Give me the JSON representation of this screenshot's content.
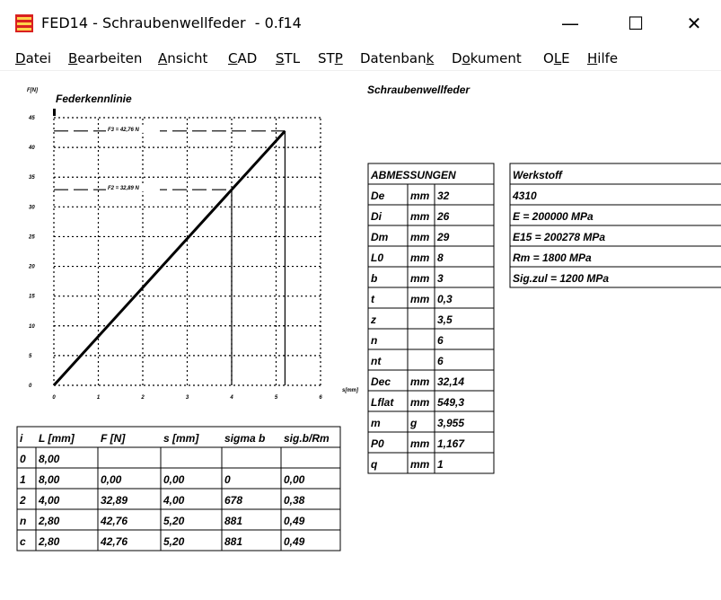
{
  "window": {
    "title": "FED14 - Schraubenwellfeder  - 0.f14",
    "minimize": "—",
    "maximize": "☐",
    "close": "✕"
  },
  "menu": [
    {
      "label": "Datei",
      "key": "D"
    },
    {
      "label": "Bearbeiten",
      "key": "B"
    },
    {
      "label": "Ansicht",
      "key": "A"
    },
    {
      "label": "CAD",
      "key": "C"
    },
    {
      "label": "STL",
      "key": "S"
    },
    {
      "label": "STP",
      "key": "P"
    },
    {
      "label": "Datenbank",
      "key": "k"
    },
    {
      "label": "Dokument",
      "key": "o"
    },
    {
      "label": "OLE",
      "key": "L"
    },
    {
      "label": "Hilfe",
      "key": "H"
    }
  ],
  "heading": "Schraubenwellfeder",
  "chart_data": {
    "type": "line",
    "title": "Federkennlinie",
    "xlabel": "s[mm]",
    "ylabel": "F[N]",
    "xlim": [
      0,
      6
    ],
    "ylim": [
      0,
      45
    ],
    "xticks": [
      "0",
      "1",
      "2",
      "3",
      "4",
      "5",
      "6"
    ],
    "yticks": [
      "0",
      "5",
      "10",
      "15",
      "20",
      "25",
      "30",
      "35",
      "40",
      "45"
    ],
    "grid": true,
    "series": [
      {
        "values": [
          [
            0,
            0
          ],
          [
            5.2,
            42.76
          ]
        ]
      }
    ],
    "markers": [
      {
        "label": "F2 = 32,89 N",
        "s": 4.0,
        "F": 32.89
      },
      {
        "label": "F3 = 42,76 N",
        "s": 5.2,
        "F": 42.76
      }
    ]
  },
  "table_dims": {
    "header": "ABMESSUNGEN",
    "rows": [
      [
        "De",
        "mm",
        "32"
      ],
      [
        "Di",
        "mm",
        "26"
      ],
      [
        "Dm",
        "mm",
        "29"
      ],
      [
        "L0",
        "mm",
        "8"
      ],
      [
        "b",
        "mm",
        "3"
      ],
      [
        "t",
        "mm",
        "0,3"
      ],
      [
        "z",
        "",
        "3,5"
      ],
      [
        "n",
        "",
        "6"
      ],
      [
        "nt",
        "",
        "6"
      ],
      [
        "Dec",
        "mm",
        "32,14"
      ],
      [
        "Lflat",
        "mm",
        "549,3"
      ],
      [
        "m",
        "g",
        "3,955"
      ],
      [
        "P0",
        "mm",
        "1,167"
      ],
      [
        "q",
        "mm",
        "1"
      ]
    ]
  },
  "table_material": {
    "header": "Werkstoff",
    "rows": [
      "4310",
      "E = 200000 MPa",
      "E15 = 200278 MPa",
      "Rm = 1800 MPa",
      "Sig.zul = 1200 MPa"
    ]
  },
  "table_points": {
    "headers": [
      "i",
      "L [mm]",
      "F [N]",
      "s [mm]",
      "sigma b",
      "sig.b/Rm"
    ],
    "rows": [
      [
        "0",
        "8,00",
        "",
        "",
        "",
        ""
      ],
      [
        "1",
        "8,00",
        "0,00",
        "0,00",
        "0",
        "0,00"
      ],
      [
        "2",
        "4,00",
        "32,89",
        "4,00",
        "678",
        "0,38"
      ],
      [
        "n",
        "2,80",
        "42,76",
        "5,20",
        "881",
        "0,49"
      ],
      [
        "c",
        "2,80",
        "42,76",
        "5,20",
        "881",
        "0,49"
      ]
    ]
  }
}
